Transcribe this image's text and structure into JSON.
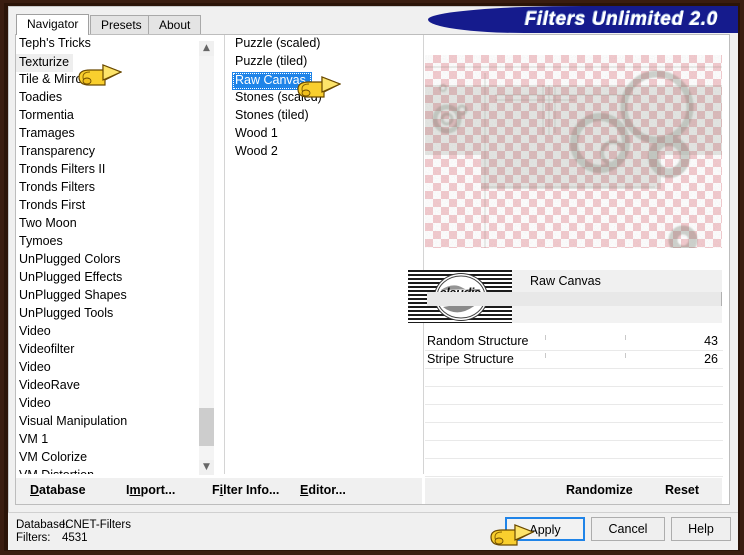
{
  "window": {
    "title": "Filters Unlimited 2.0",
    "accent_color": "#151b8d"
  },
  "tabs": [
    {
      "label": "Navigator",
      "active": true
    },
    {
      "label": "Presets",
      "active": false
    },
    {
      "label": "About",
      "active": false
    }
  ],
  "category_list": {
    "scroll_position": "near-bottom",
    "selected": "Texturize",
    "items": [
      "Teph's Tricks",
      "Texturize",
      "Tile & Mirror",
      "Toadies",
      "Tormentia",
      "Tramages",
      "Transparency",
      "Tronds Filters II",
      "Tronds Filters",
      "Tronds First",
      "Two Moon",
      "Tymoes",
      "UnPlugged Colors",
      "UnPlugged Effects",
      "UnPlugged Shapes",
      "UnPlugged Tools",
      "Video",
      "Videofilter",
      "Video",
      "VideoRave",
      "Video",
      "Visual Manipulation",
      "VM 1",
      "VM Colorize",
      "VM Distortion"
    ]
  },
  "effect_list": {
    "selected": "Raw Canvas",
    "items": [
      "Puzzle (scaled)",
      "Puzzle (tiled)",
      "Raw Canvas",
      "Stones (scaled)",
      "Stones (tiled)",
      "Wood 1",
      "Wood 2"
    ]
  },
  "preview": {
    "effect_name": "Raw Canvas",
    "watermark_text": "claudia"
  },
  "parameters": [
    {
      "name": "Random Structure",
      "value": "43"
    },
    {
      "name": "Stripe Structure",
      "value": "26"
    }
  ],
  "toolbar_links": [
    {
      "label": "Database",
      "accel": "D"
    },
    {
      "label": "Import...",
      "accel": "I"
    },
    {
      "label": "Filter Info...",
      "accel": "I"
    },
    {
      "label": "Editor...",
      "accel": "E"
    },
    {
      "label": "Randomize",
      "accel": ""
    },
    {
      "label": "Reset",
      "accel": ""
    }
  ],
  "status": {
    "database_label": "Database:",
    "database_value": "ICNET-Filters",
    "filters_label": "Filters:",
    "filters_value": "4531"
  },
  "buttons": {
    "apply": "Apply",
    "cancel": "Cancel",
    "help": "Help"
  }
}
